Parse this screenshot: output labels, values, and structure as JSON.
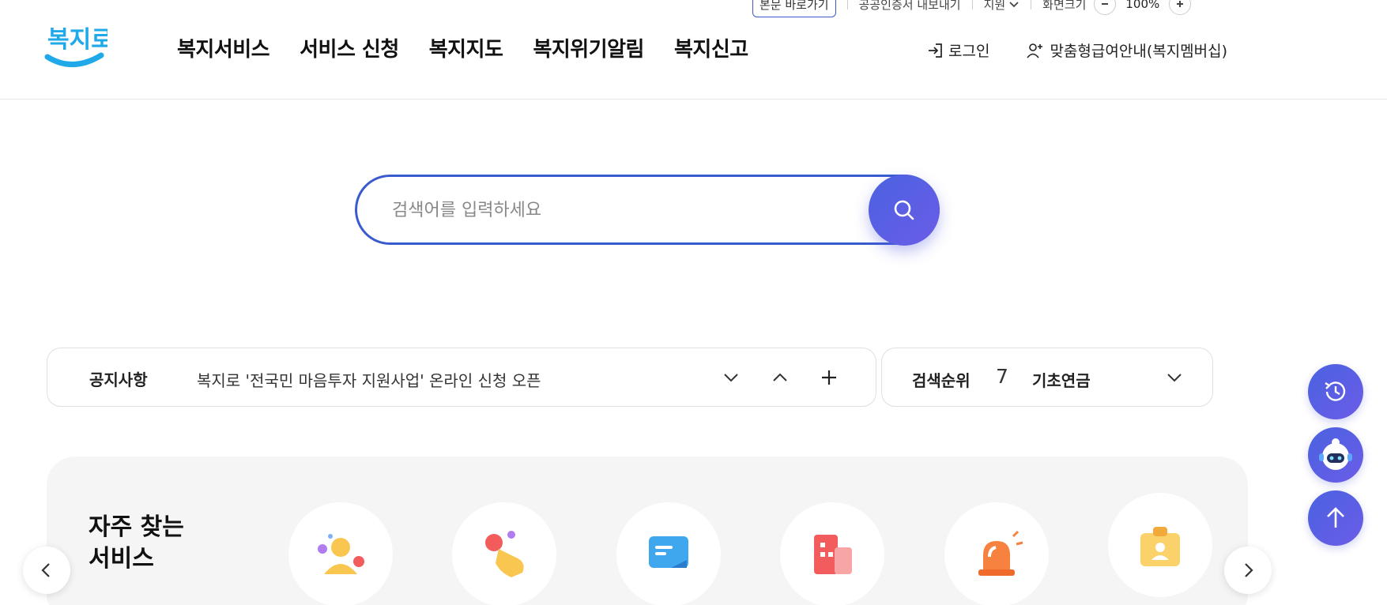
{
  "utility": {
    "skip_label": "본문 바로가기",
    "share_label": "공공인증서 내보내기",
    "lang_label": "지원",
    "zoom_label": "화면크기",
    "zoom_value": "100%"
  },
  "header": {
    "logo_text": "복지로",
    "nav": [
      "복지서비스",
      "서비스 신청",
      "복지지도",
      "복지위기알림",
      "복지신고"
    ],
    "login_label": "로그인",
    "membership_label": "맞춤형급여안내(복지멤버십)"
  },
  "search": {
    "placeholder": "검색어를 입력하세요"
  },
  "notice": {
    "label": "공지사항",
    "text": "복지로 '전국민 마음투자 지원사업' 온라인 신청 오픈"
  },
  "ranking": {
    "label": "검색순위",
    "rank": "7",
    "keyword": "기초연금"
  },
  "frequent": {
    "title_line1": "자주 찾는",
    "title_line2": "서비스",
    "icons": [
      "people-icon",
      "hand-touch-icon",
      "chat-card-icon",
      "building-icon",
      "siren-icon",
      "id-card-icon"
    ]
  },
  "colors": {
    "primary": "#3a5bd0",
    "primary_gradient_end": "#6b5ce8",
    "logo_blue": "#1fa9e8",
    "panel_bg": "#f5f5f6"
  }
}
